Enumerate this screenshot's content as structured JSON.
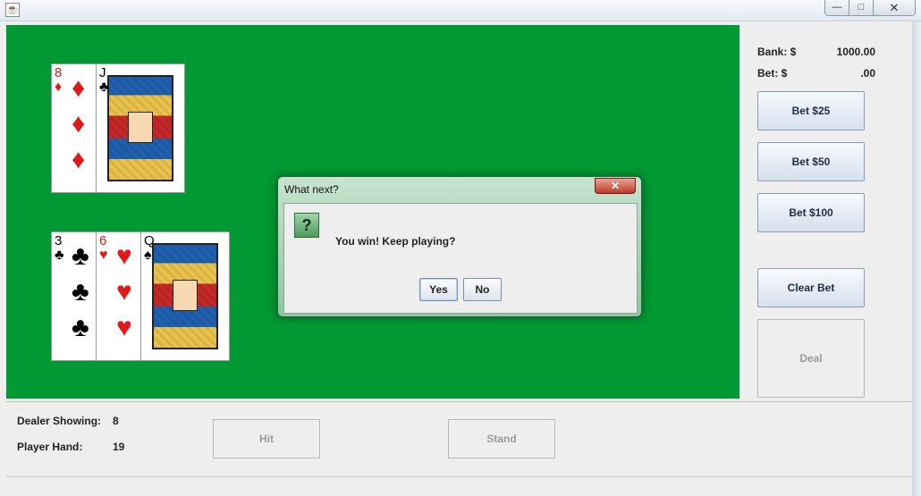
{
  "window": {
    "controls": {
      "minimize": "—",
      "maximize": "□",
      "close": "✕"
    }
  },
  "dealer_hand": [
    {
      "rank": "8",
      "suit": "♦",
      "color": "red"
    },
    {
      "rank": "J",
      "suit": "♣",
      "color": "black",
      "face": true
    }
  ],
  "player_hand": [
    {
      "rank": "3",
      "suit": "♣",
      "color": "black"
    },
    {
      "rank": "6",
      "suit": "♥",
      "color": "red"
    },
    {
      "rank": "Q",
      "suit": "♠",
      "color": "black",
      "face": true
    }
  ],
  "dialog": {
    "title": "What next?",
    "close": "✕",
    "icon": "?",
    "message": "You win! Keep playing?",
    "yes_label": "Yes",
    "no_label": "No"
  },
  "side_panel": {
    "bank_label": "Bank: $",
    "bank_value": "1000.00",
    "bet_label": "Bet: $",
    "bet_value": ".00",
    "bet25_label": "Bet $25",
    "bet50_label": "Bet $50",
    "bet100_label": "Bet $100",
    "clear_bet_label": "Clear Bet",
    "deal_label": "Deal"
  },
  "bottom_panel": {
    "dealer_showing_label": "Dealer Showing:",
    "dealer_showing_value": "8",
    "player_hand_label": "Player Hand:",
    "player_hand_value": "19",
    "hit_label": "Hit",
    "stand_label": "Stand"
  },
  "colors": {
    "felt": "#009933",
    "red_suit": "#e01a1a",
    "dialog_frame": "#8fc7a0"
  }
}
